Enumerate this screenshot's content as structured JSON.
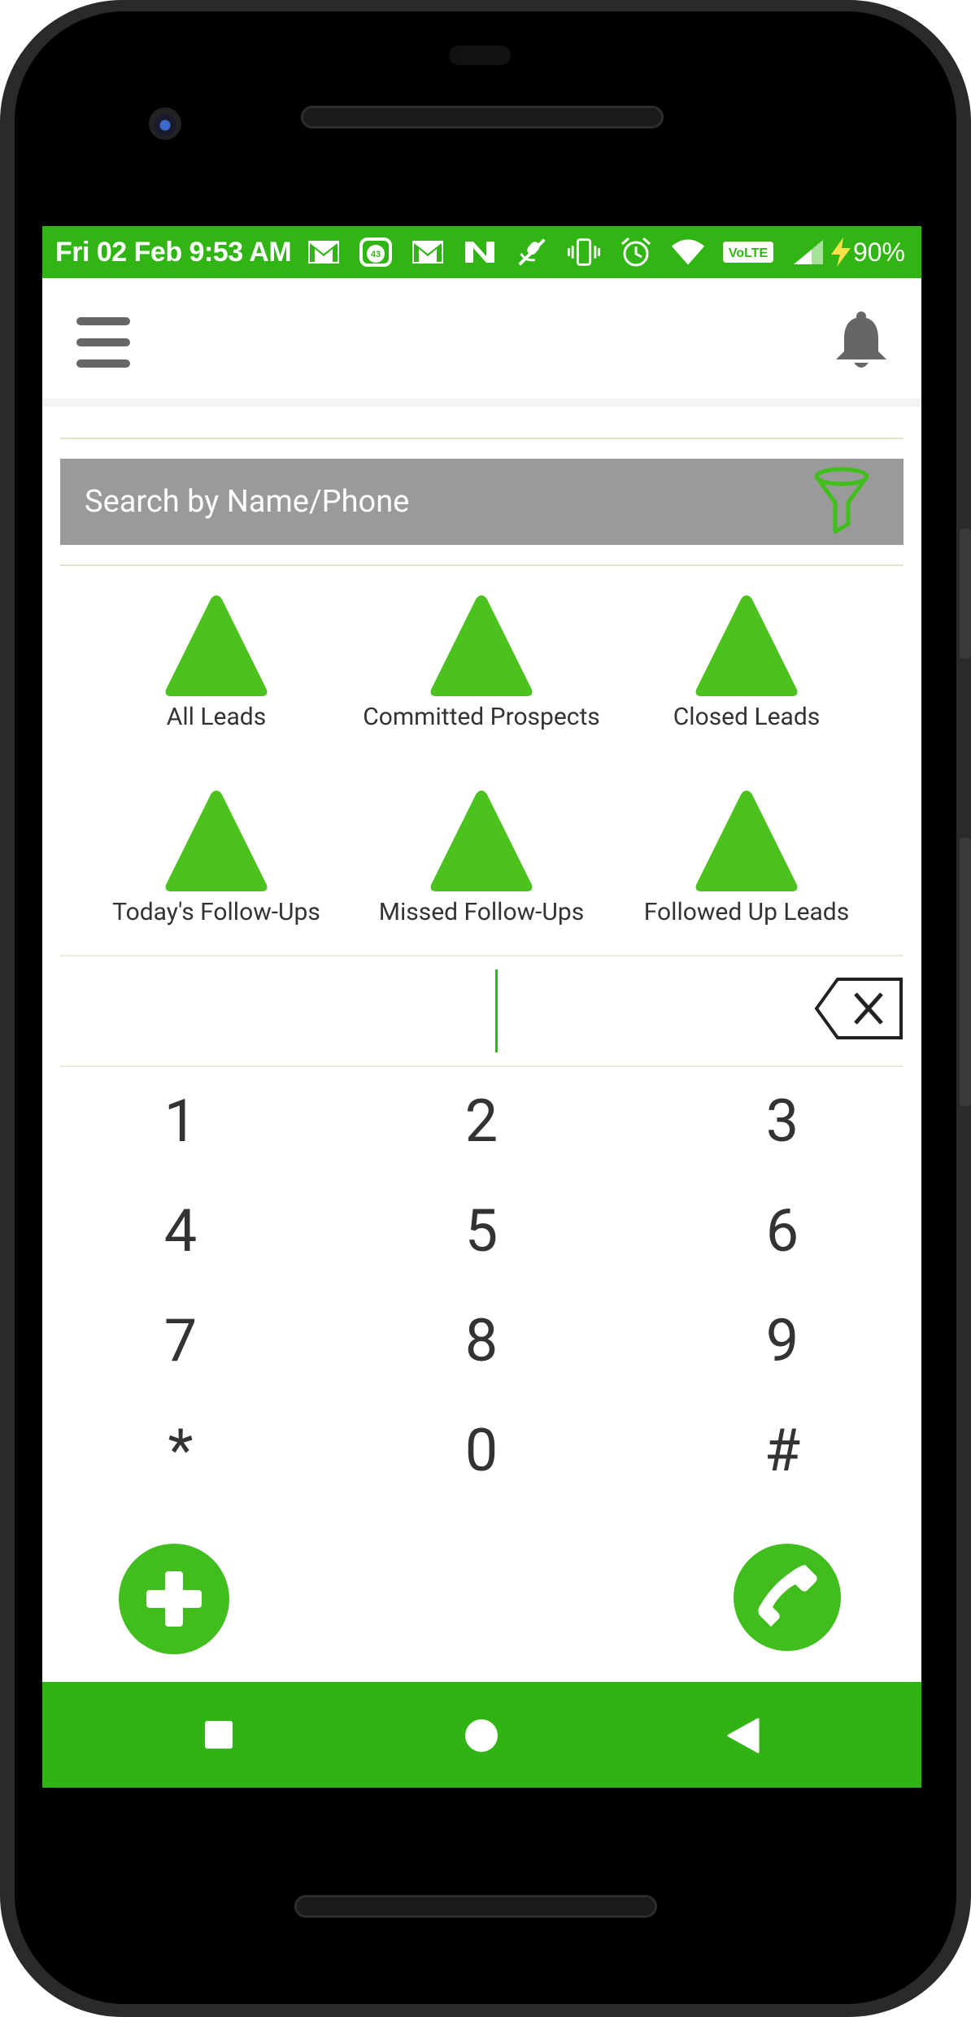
{
  "status_bar": {
    "time": "Fri 02 Feb 9:53 AM",
    "battery": "90%",
    "notification_badge": "43",
    "volte": "VoLTE",
    "icons": [
      "gmail-icon",
      "badge-app-icon",
      "gmail-icon",
      "n-app-icon",
      "mic-off-icon",
      "vibrate-icon",
      "alarm-icon",
      "wifi-icon",
      "volte-icon",
      "signal-icon",
      "charging-icon"
    ]
  },
  "app_bar": {
    "menu_icon": "hamburger-menu-icon",
    "notifications_icon": "bell-icon"
  },
  "search": {
    "placeholder": "Search by Name/Phone",
    "value": "",
    "filter_icon": "funnel-filter-icon"
  },
  "categories": [
    {
      "label": "All Leads"
    },
    {
      "label": "Committed Prospects"
    },
    {
      "label": "Closed Leads"
    },
    {
      "label": "Today's Follow-Ups"
    },
    {
      "label": "Missed Follow-Ups"
    },
    {
      "label": "Followed Up Leads"
    }
  ],
  "dialer": {
    "input_value": "",
    "keys": [
      "1",
      "2",
      "3",
      "4",
      "5",
      "6",
      "7",
      "8",
      "9",
      "*",
      "0",
      "#"
    ]
  },
  "actions": {
    "add_icon": "plus-icon",
    "call_icon": "phone-call-icon"
  },
  "colors": {
    "primary_green": "#31b514",
    "accent_green": "#4cc21f",
    "search_gray": "#9a9a9a",
    "text_dark": "#333333"
  }
}
